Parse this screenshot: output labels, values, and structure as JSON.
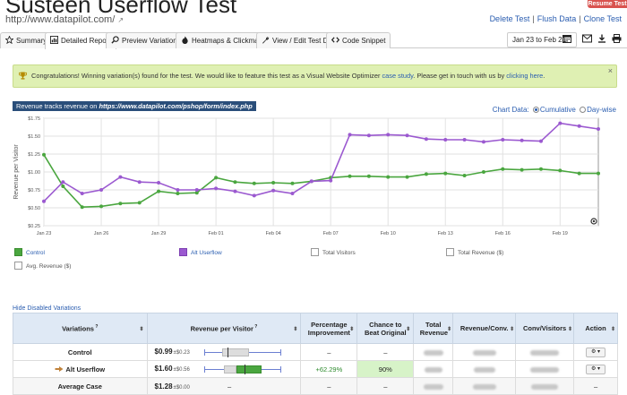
{
  "header": {
    "title": "Susteen Userflow Test",
    "url": "http://www.datapilot.com/",
    "resume_label": "Resume Test",
    "links": {
      "delete": "Delete Test",
      "flush": "Flush Data",
      "clone": "Clone Test"
    }
  },
  "tabs": [
    {
      "label": "Summary",
      "icon": "star-icon"
    },
    {
      "label": "Detailed Report",
      "icon": "report-icon",
      "active": true
    },
    {
      "label": "Preview Variations",
      "icon": "magnifier-icon"
    },
    {
      "label": "Heatmaps & Clickmaps",
      "icon": "fire-icon"
    },
    {
      "label": "View / Edit Test Details",
      "icon": "wrench-icon"
    },
    {
      "label": "Code Snippet",
      "icon": "code-icon"
    }
  ],
  "date_range": "Jan 23 to Feb 21",
  "alert": {
    "text_before": "Congratulations! Winning variation(s) found for the test. We would like to feature this test as a Visual Website Optimizer ",
    "link1": "case study",
    "text_middle": ". Please get in touch with us by ",
    "link2": "clicking here",
    "text_after": ".",
    "close": "×"
  },
  "chart_caption": {
    "prefix": "Revenue tracks revenue on ",
    "url": "https://www.datapilot.com/pshop/form/index.php"
  },
  "chart_controls": {
    "label": "Chart Data:",
    "option1": "Cumulative",
    "option2": "Day-wise",
    "selected": "Cumulative"
  },
  "chart_data": {
    "type": "line",
    "ylabel": "Revenue per Visitor",
    "yticks": [
      "$0.25",
      "$0.50",
      "$0.75",
      "$1.00",
      "$1.25",
      "$1.50",
      "$1.75"
    ],
    "ylim": [
      0.25,
      1.75
    ],
    "xticks": [
      "Jan 23",
      "Jan 26",
      "Jan 29",
      "Feb 01",
      "Feb 04",
      "Feb 07",
      "Feb 10",
      "Feb 13",
      "Feb 16",
      "Feb 19"
    ],
    "x": [
      "Jan 23",
      "Jan 24",
      "Jan 25",
      "Jan 26",
      "Jan 27",
      "Jan 28",
      "Jan 29",
      "Jan 30",
      "Jan 31",
      "Feb 01",
      "Feb 02",
      "Feb 03",
      "Feb 04",
      "Feb 05",
      "Feb 06",
      "Feb 07",
      "Feb 08",
      "Feb 09",
      "Feb 10",
      "Feb 11",
      "Feb 12",
      "Feb 13",
      "Feb 14",
      "Feb 15",
      "Feb 16",
      "Feb 17",
      "Feb 18",
      "Feb 19",
      "Feb 20",
      "Feb 21"
    ],
    "grid": true,
    "series": [
      {
        "name": "Control",
        "color": "#4aa63f",
        "values": [
          1.24,
          0.8,
          0.51,
          0.52,
          0.56,
          0.57,
          0.73,
          0.7,
          0.71,
          0.92,
          0.86,
          0.84,
          0.85,
          0.84,
          0.87,
          0.92,
          0.94,
          0.94,
          0.93,
          0.93,
          0.97,
          0.98,
          0.95,
          1.0,
          1.04,
          1.03,
          1.04,
          1.02,
          0.98,
          0.98
        ]
      },
      {
        "name": "Alt Userflow",
        "color": "#9b59d0",
        "values": [
          0.59,
          0.86,
          0.7,
          0.75,
          0.93,
          0.86,
          0.85,
          0.75,
          0.75,
          0.77,
          0.73,
          0.67,
          0.74,
          0.7,
          0.87,
          0.88,
          1.52,
          1.51,
          1.52,
          1.51,
          1.46,
          1.45,
          1.45,
          1.42,
          1.45,
          1.44,
          1.43,
          1.68,
          1.64,
          1.6
        ]
      }
    ]
  },
  "legend": {
    "control": "Control",
    "alt": "Alt Userflow",
    "visitors": "Total Visitors",
    "revenue": "Total Revenue ($)",
    "avg_revenue": "Avg. Revenue ($)"
  },
  "hide_disabled": "Hide Disabled Variations",
  "table": {
    "headers": {
      "variations": "Variations",
      "rpv": "Revenue per Visitor",
      "improvement": "Percentage Improvement",
      "chance": "Chance to Beat Original",
      "total_revenue": "Total Revenue",
      "rev_conv": "Revenue/Conv.",
      "conv_visitors": "Conv/Visitors",
      "action": "Action"
    },
    "rows": [
      {
        "name": "Control",
        "rpv": "$0.99",
        "se": "±$0.23",
        "improvement": "–",
        "chance": "–",
        "action": "⚙ ▾"
      },
      {
        "name": "Alt Userflow",
        "rpv": "$1.60",
        "se": "±$0.56",
        "improvement": "+62.29%",
        "chance": "90%",
        "action": "⚙ ▾"
      },
      {
        "name": "Average Case",
        "rpv": "$1.28",
        "se": "±$0.00",
        "improvement": "–",
        "chance": "–",
        "ci": "–",
        "action": "–"
      }
    ]
  }
}
